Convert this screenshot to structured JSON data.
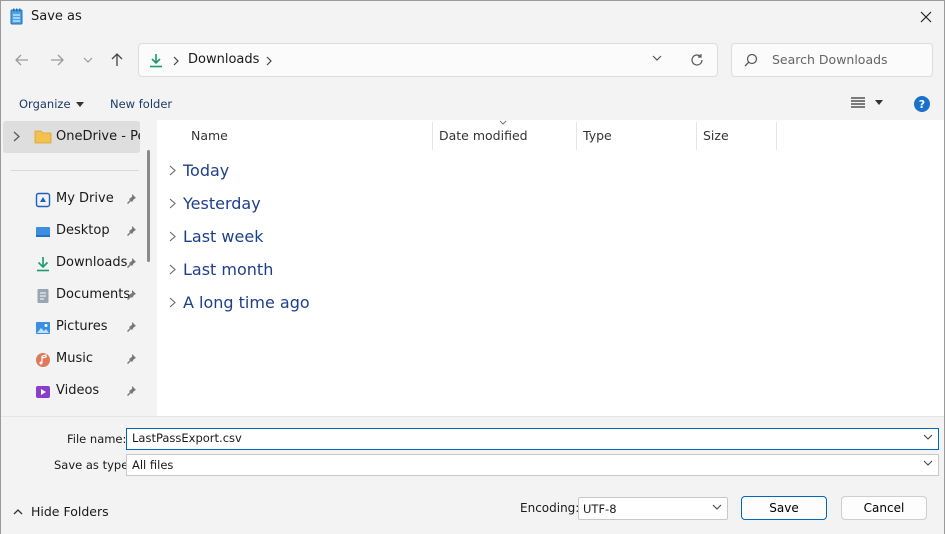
{
  "window": {
    "title": "Save as"
  },
  "address": {
    "crumb": "Downloads"
  },
  "search": {
    "placeholder": "Search Downloads"
  },
  "toolbar": {
    "organize": "Organize",
    "new_folder": "New folder",
    "help": "?"
  },
  "sidebar": {
    "top_item": "OneDrive - Pe",
    "items": [
      {
        "label": "My Drive",
        "icon": "drive-icon"
      },
      {
        "label": "Desktop",
        "icon": "desktop-icon"
      },
      {
        "label": "Downloads",
        "icon": "download-icon"
      },
      {
        "label": "Documents",
        "icon": "documents-icon"
      },
      {
        "label": "Pictures",
        "icon": "pictures-icon"
      },
      {
        "label": "Music",
        "icon": "music-icon"
      },
      {
        "label": "Videos",
        "icon": "videos-icon"
      }
    ]
  },
  "columns": {
    "name": "Name",
    "date": "Date modified",
    "type": "Type",
    "size": "Size"
  },
  "groups": [
    "Today",
    "Yesterday",
    "Last week",
    "Last month",
    "A long time ago"
  ],
  "form": {
    "file_name_label": "File name:",
    "file_name_value": "LastPassExport.csv",
    "save_type_label": "Save as type:",
    "save_type_value": "All files",
    "hide_folders": "Hide Folders",
    "encoding_label": "Encoding:",
    "encoding_value": "UTF-8",
    "save": "Save",
    "cancel": "Cancel"
  },
  "colors": {
    "accent": "#0067c0",
    "group_text": "#1d3f8a",
    "help_bg": "#1a73c8"
  }
}
